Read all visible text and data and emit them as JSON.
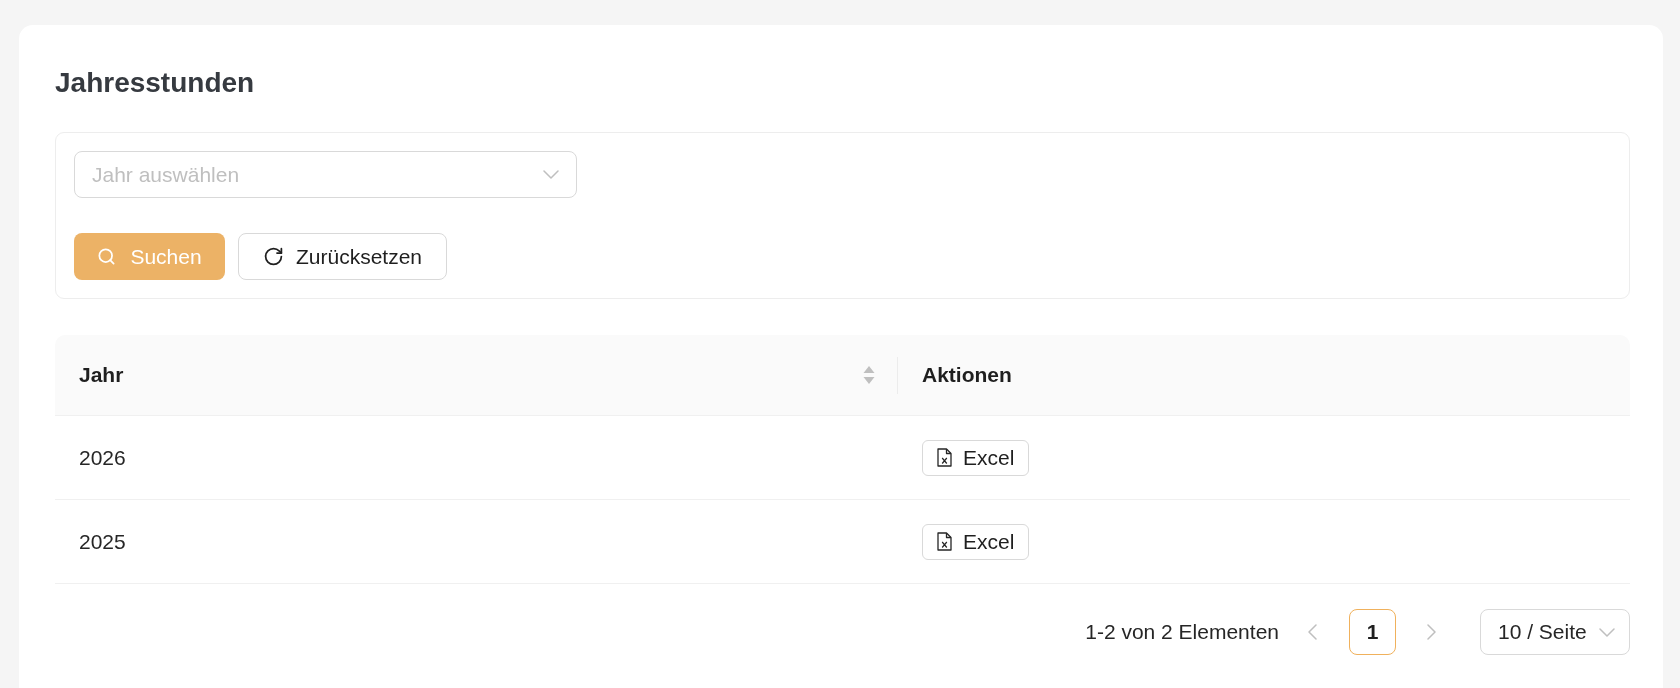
{
  "page": {
    "title": "Jahresstunden"
  },
  "filter": {
    "year_select": {
      "placeholder": "Jahr auswählen"
    },
    "buttons": [
      {
        "kind": "search",
        "label": "Suchen"
      },
      {
        "kind": "reset",
        "label": "Zurücksetzen"
      }
    ]
  },
  "table": {
    "columns": [
      {
        "label": "Jahr",
        "sortable": true
      },
      {
        "label": "Aktionen",
        "sortable": false
      }
    ],
    "rows": [
      {
        "year": "2026",
        "action": "Excel"
      },
      {
        "year": "2025",
        "action": "Excel"
      }
    ]
  },
  "pagination": {
    "summary": "1-2 von 2 Elementen",
    "pages": [
      {
        "label": "1",
        "selected": true
      }
    ],
    "page_size": "10 / Seite"
  }
}
